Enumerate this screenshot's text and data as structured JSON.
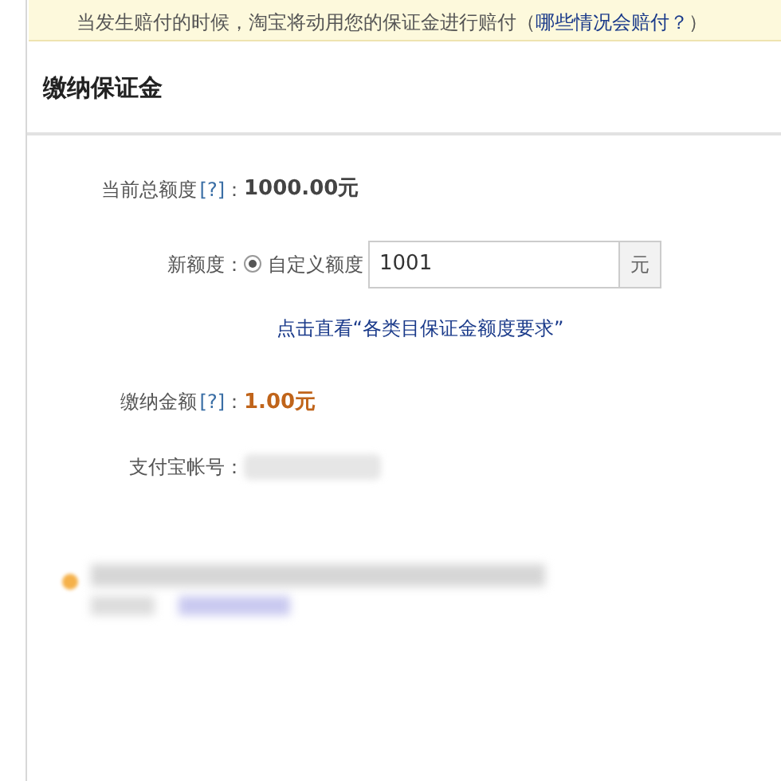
{
  "notice": {
    "text": "当发生赔付的时候，淘宝将动用您的保证金进行赔付（",
    "link": "哪些情况会赔付？",
    "suffix": "）"
  },
  "section_title": "缴纳保证金",
  "current_limit": {
    "label": "当前总额度",
    "help": "[?]",
    "colon": "：",
    "value": "1000.00元"
  },
  "new_limit": {
    "label": "新额度：",
    "option": {
      "label": "自定义额度",
      "selected": true
    },
    "value": "1001",
    "unit": "元"
  },
  "requirements_link": "点击直看“各类目保证金额度要求”",
  "payment_amount": {
    "label": "缴纳金额",
    "help": "[?]",
    "colon": "：",
    "value": "1.00元"
  },
  "alipay_account": {
    "label": "支付宝帐号："
  }
}
